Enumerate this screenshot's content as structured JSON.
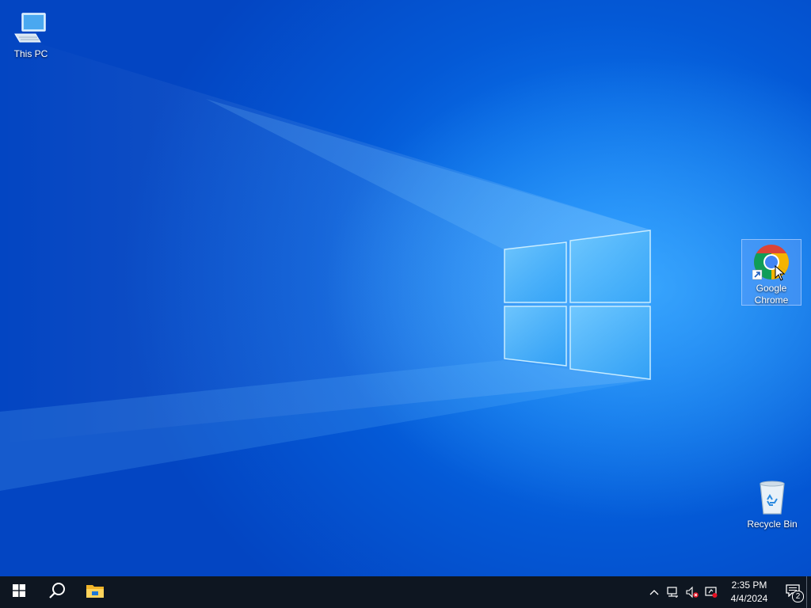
{
  "desktop": {
    "icons": [
      {
        "label": "This PC",
        "icon": "computer-icon"
      },
      {
        "label": "Google\nChrome",
        "label_line1": "Google",
        "label_line2": "Chrome",
        "icon": "chrome-icon",
        "selected": true
      },
      {
        "label": "Recycle Bin",
        "icon": "recycle-bin-icon"
      }
    ]
  },
  "taskbar": {
    "start_icon": "windows-logo-icon",
    "search_icon": "search-icon",
    "pinned": [
      {
        "name": "File Explorer",
        "icon": "folder-icon"
      }
    ],
    "tray": {
      "icons": [
        "chevron-up-icon",
        "network-icon",
        "volume-muted-icon",
        "security-icon"
      ],
      "time": "2:35 PM",
      "date": "4/4/2024",
      "notification_count": "2"
    }
  },
  "colors": {
    "taskbar": "#0e1621",
    "wallpaper_primary": "#0a6fe8",
    "selection": "#78aaff"
  }
}
